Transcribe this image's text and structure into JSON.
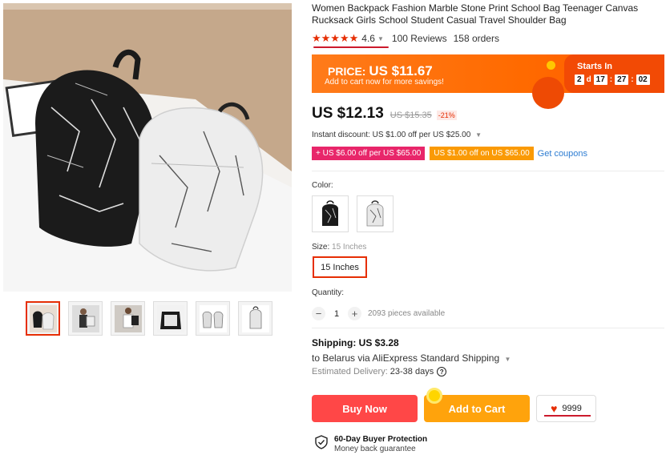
{
  "product": {
    "title": "Women Backpack Fashion Marble Stone Print School Bag Teenager Canvas Rucksack Girls School Student Casual Travel Shoulder Bag",
    "stars": "★★★★★",
    "rating": "4.6",
    "reviews": "100 Reviews",
    "orders": "158 orders"
  },
  "promo": {
    "price_label": "PRICE:",
    "price_value": "US $11.67",
    "subtext": "Add to cart now for more savings!",
    "starts_in": "Starts In",
    "days": "2",
    "days_unit": "d",
    "hours": "17",
    "minutes": "27",
    "seconds": "02"
  },
  "price": {
    "current": "US $12.13",
    "original": "US $15.35",
    "discount": "-21%"
  },
  "instant_discount": "Instant discount: US $1.00 off per US $25.00",
  "coupons": {
    "pink": "+ US $6.00 off per US $65.00",
    "orange": "US $1.00 off on US $65.00",
    "get": "Get coupons"
  },
  "color": {
    "label": "Color:",
    "options": [
      "black-marble",
      "white-marble"
    ]
  },
  "size": {
    "label": "Size:",
    "selected_hint": "15 Inches",
    "option": "15 Inches"
  },
  "quantity": {
    "label": "Quantity:",
    "minus": "−",
    "value": "1",
    "plus": "+",
    "available": "2093 pieces available"
  },
  "shipping": {
    "title": "Shipping: US $3.28",
    "to": "to Belarus via AliExpress Standard Shipping",
    "estimated_label": "Estimated Delivery:",
    "estimated_value": "23-38 days",
    "help": "?"
  },
  "actions": {
    "buy_now": "Buy Now",
    "add_to_cart": "Add to Cart",
    "wishlist_count": "9999"
  },
  "protection": {
    "title": "60-Day Buyer Protection",
    "subtitle": "Money back guarantee"
  },
  "colors": {
    "accent": "#e62e04",
    "buy": "#ff4747",
    "cart": "#ffa30c",
    "promo": "#ff6a00",
    "coupon_pink": "#e8266a",
    "coupon_orange": "#fa9a05",
    "link": "#2e7dd2"
  },
  "gallery": {
    "thumbnails": [
      "both-bags",
      "model-front",
      "model-side",
      "open-bag",
      "two-white-bags",
      "white-bag"
    ]
  }
}
